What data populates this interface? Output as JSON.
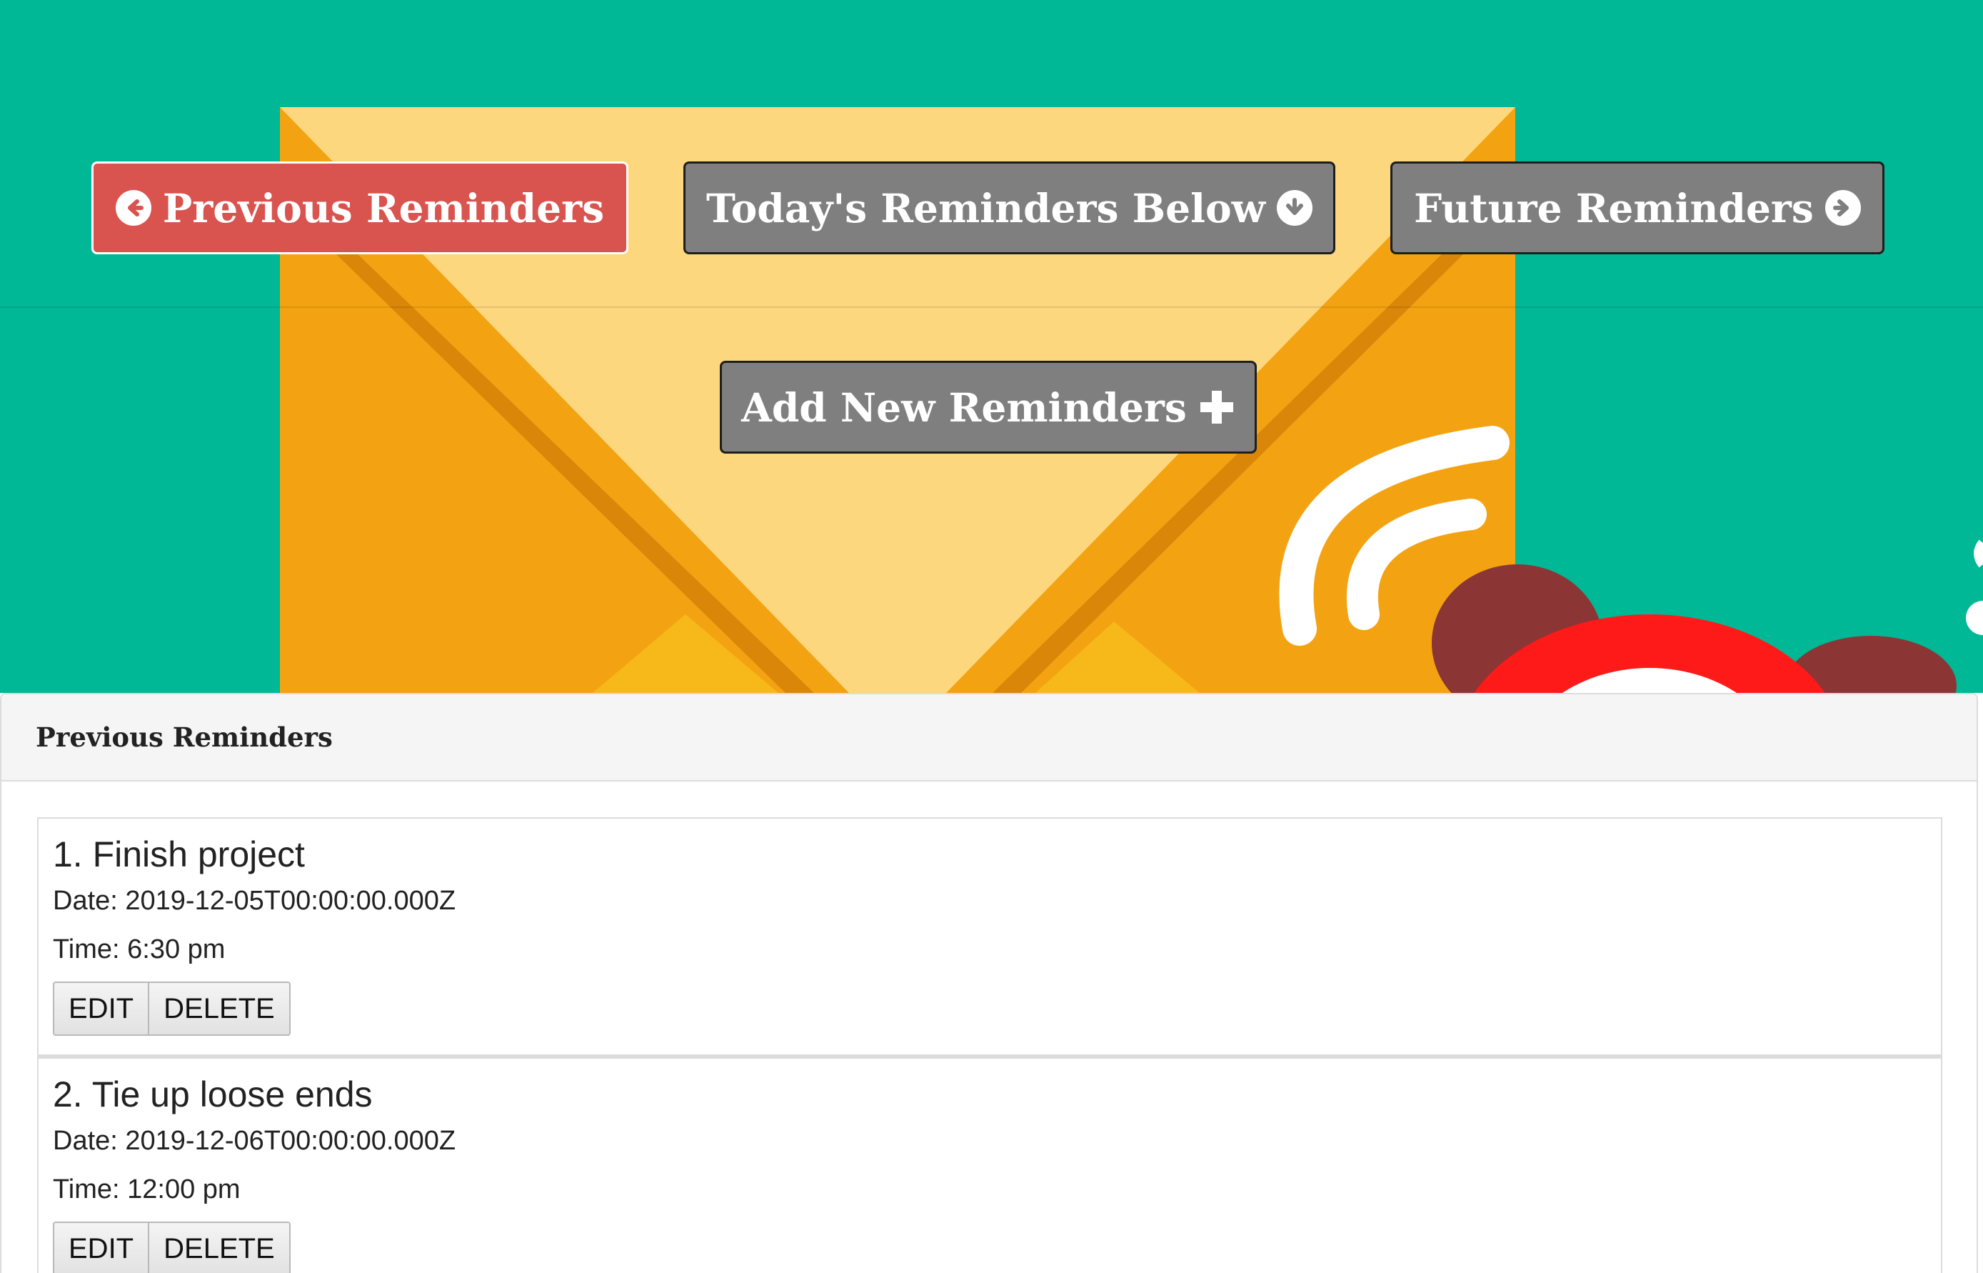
{
  "colors": {
    "hero_background": "#00b796",
    "previous_button": "#d9534f",
    "nav_button": "#7f7f7f",
    "envelope": "#f3a312",
    "envelope_flap": "#fdd77e",
    "clock": "#ff1a1a"
  },
  "nav": {
    "previous": {
      "label": "Previous Reminders",
      "icon": "arrow-circle-left-icon"
    },
    "today": {
      "label": "Today's Reminders Below",
      "icon": "arrow-circle-down-icon"
    },
    "future": {
      "label": "Future Reminders",
      "icon": "arrow-circle-right-icon"
    },
    "add": {
      "label": "Add New Reminders",
      "icon": "plus-icon"
    }
  },
  "panel": {
    "heading": "Previous Reminders",
    "reminders": [
      {
        "title": "1. Finish project",
        "date": "Date: 2019-12-05T00:00:00.000Z",
        "time": "Time: 6:30 pm",
        "edit_label": "EDIT",
        "delete_label": "DELETE"
      },
      {
        "title": "2. Tie up loose ends",
        "date": "Date: 2019-12-06T00:00:00.000Z",
        "time": "Time: 12:00 pm",
        "edit_label": "EDIT",
        "delete_label": "DELETE"
      }
    ]
  }
}
